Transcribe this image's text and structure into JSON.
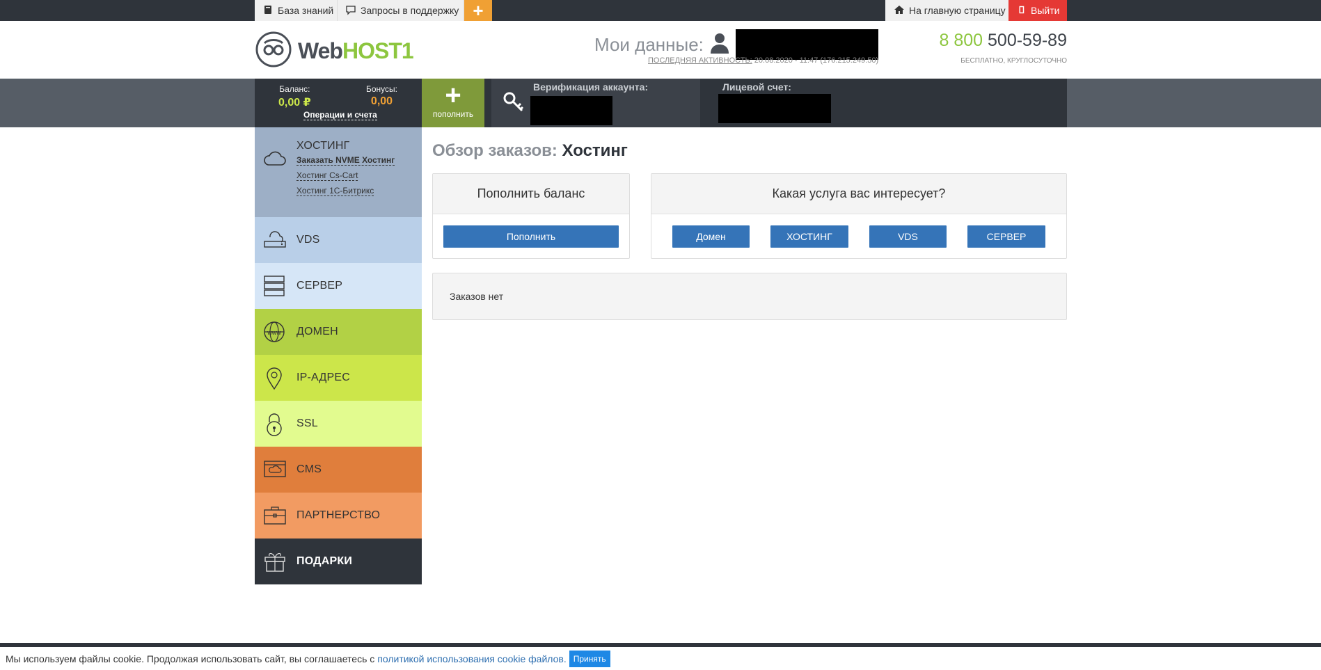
{
  "topbar": {
    "kb_label": "База знаний",
    "support_label": "Запросы в поддержку",
    "plus_label": "+",
    "home_label": "На главную страницу",
    "exit_label": "Выйти"
  },
  "header": {
    "logo_web": "Web",
    "logo_host": "HOST1",
    "mydata_label": "Мои данные:",
    "last_activity_label": "ПОСЛЕДНЯЯ АКТИВНОСТЬ:",
    "last_activity_value": "20.08.2020 - 11:47 (176.215.249.50)",
    "phone_prefix": "8 800",
    "phone_number": "500-59-89",
    "phone_note": "БЕСПЛАТНО, КРУГЛОСУТОЧНО"
  },
  "account": {
    "balance_label": "Баланс:",
    "balance_value": "0,00 ₽",
    "bonus_label": "Бонусы:",
    "bonus_value": "0,00",
    "operations_link": "Операции и счета",
    "topup_plus": "+",
    "topup_label": "пополнить",
    "verification_label": "Верификация аккаунта:",
    "account_no_label": "Лицевой счет:"
  },
  "sidebar": {
    "hosting": {
      "label": "ХОСТИНГ",
      "links": [
        "Заказать NVME Хостинг",
        "Хостинг Cs-Cart",
        "Хостинг 1С-Битрикс"
      ]
    },
    "items": [
      {
        "label": "VDS",
        "color": "#b9cfe8"
      },
      {
        "label": "СЕРВЕР",
        "color": "#d6e6f7"
      },
      {
        "label": "ДОМЕН",
        "color": "#b2d145"
      },
      {
        "label": "IP-АДРЕС",
        "color": "#cce64a"
      },
      {
        "label": "SSL",
        "color": "#e2fb8f"
      },
      {
        "label": "CMS",
        "color": "#e07e3c"
      },
      {
        "label": "ПАРТНЕРСТВО",
        "color": "#f29b62"
      },
      {
        "label": "ПОДАРКИ",
        "color": "#2f343b"
      }
    ]
  },
  "main": {
    "title_prefix": "Обзор заказов:",
    "title_section": "Хостинг",
    "balance_card_title": "Пополнить баланс",
    "balance_card_button": "Пополнить",
    "services_card_title": "Какая услуга вас интересует?",
    "services": [
      "Домен",
      "ХОСТИНГ",
      "VDS",
      "СЕРВЕР"
    ],
    "orders_empty": "Заказов нет"
  },
  "cookie": {
    "text": "Мы используем файлы cookie. Продолжая использовать сайт, вы соглашаетесь с",
    "link": "политикой использования cookie файлов.",
    "accept": "Принять"
  }
}
